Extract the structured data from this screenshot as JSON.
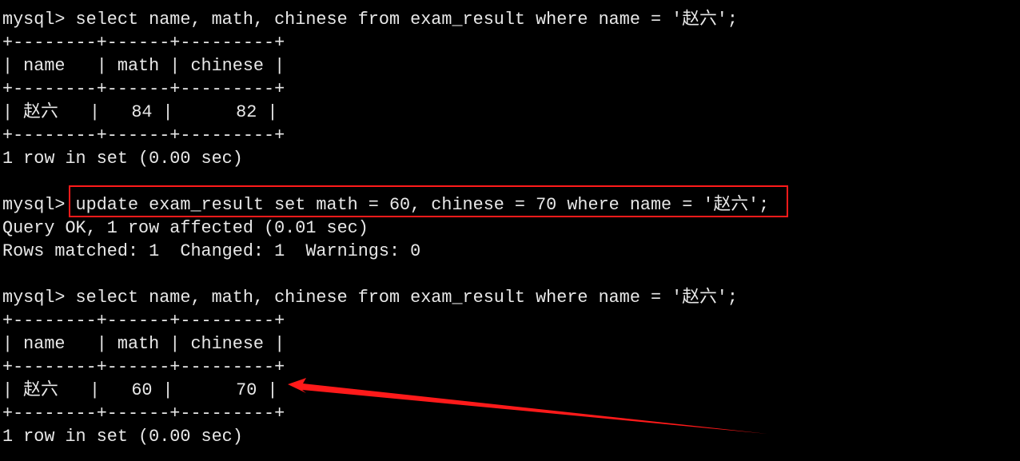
{
  "terminal": {
    "lines": [
      "mysql> select name, math, chinese from exam_result where name = '赵六';",
      "+--------+------+---------+",
      "| name   | math | chinese |",
      "+--------+------+---------+",
      "| 赵六   |   84 |      82 |",
      "+--------+------+---------+",
      "1 row in set (0.00 sec)",
      "",
      "mysql> update exam_result set math = 60, chinese = 70 where name = '赵六';",
      "Query OK, 1 row affected (0.01 sec)",
      "Rows matched: 1  Changed: 1  Warnings: 0",
      "",
      "mysql> select name, math, chinese from exam_result where name = '赵六';",
      "+--------+------+---------+",
      "| name   | math | chinese |",
      "+--------+------+---------+",
      "| 赵六   |   60 |      70 |",
      "+--------+------+---------+",
      "1 row in set (0.00 sec)"
    ]
  },
  "annotations": {
    "highlight_color": "#ff1a1a",
    "arrow_color": "#ff1a1a"
  }
}
